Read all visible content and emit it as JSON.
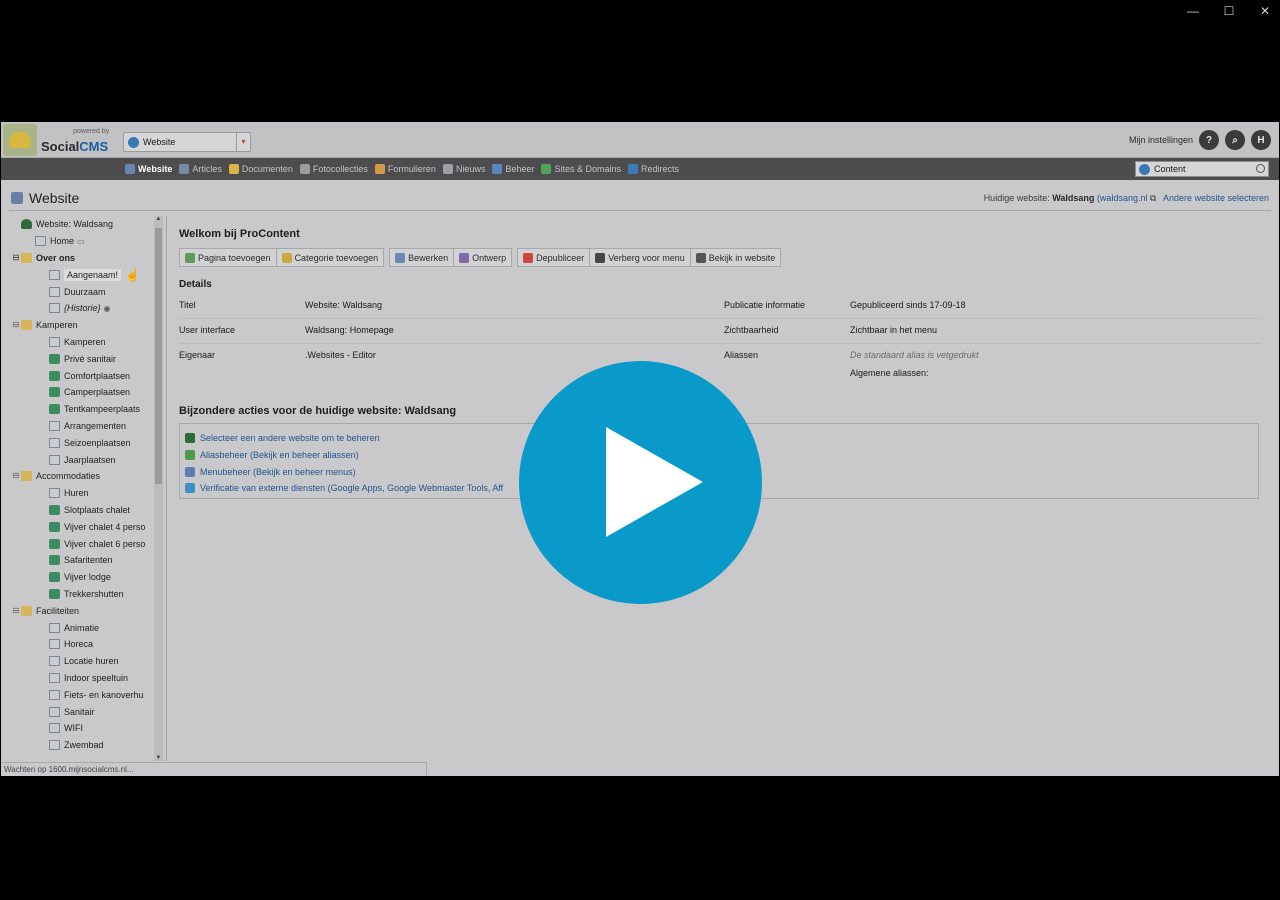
{
  "window": {
    "minimize": "—",
    "maximize": "☐",
    "close": "✕"
  },
  "header": {
    "powered_by": "powered by",
    "brand_social": "Social",
    "brand_cms": "CMS",
    "site_select_value": "Website",
    "settings_label": "Mijn instellingen",
    "help_label": "?",
    "avatar_label": "H"
  },
  "nav": {
    "items": [
      {
        "label": "Website",
        "icon": "website-icon",
        "color": "#6a86b0"
      },
      {
        "label": "Articles",
        "icon": "articles-icon",
        "color": "#7a8aa6"
      },
      {
        "label": "Documenten",
        "icon": "documenten-icon",
        "color": "#d8b545"
      },
      {
        "label": "Fotocollecties",
        "icon": "fotocollecties-icon",
        "color": "#9c9c9c"
      },
      {
        "label": "Formulieren",
        "icon": "formulieren-icon",
        "color": "#d29a48"
      },
      {
        "label": "Nieuws",
        "icon": "nieuws-icon",
        "color": "#9aa0a8"
      },
      {
        "label": "Beheer",
        "icon": "beheer-icon",
        "color": "#5f86b8"
      },
      {
        "label": "Sites & Domains",
        "icon": "sites-domains-icon",
        "color": "#4fa45a"
      },
      {
        "label": "Redirects",
        "icon": "redirects-icon",
        "color": "#3c7bb8"
      }
    ],
    "search_value": "Content"
  },
  "page": {
    "title": "Website",
    "current_label": "Huidige website:",
    "current_name": "Waldsang",
    "current_domain": "(waldsang.nl",
    "other_link": "Andere website selecteren"
  },
  "tree": [
    {
      "label": "Website: Waldsang",
      "icon": "root",
      "indent": 0,
      "toggle": ""
    },
    {
      "label": "Home",
      "icon": "page",
      "indent": 1,
      "toggle": "",
      "suffix": "▭"
    },
    {
      "label": "Over ons",
      "icon": "folder",
      "indent": 0,
      "toggle": "⊟",
      "bold": true
    },
    {
      "label": "Aangenaam!",
      "icon": "page",
      "indent": 2,
      "toggle": "",
      "hl": true
    },
    {
      "label": "Duurzaam",
      "icon": "page",
      "indent": 2,
      "toggle": ""
    },
    {
      "label": "{Historie}",
      "icon": "page",
      "indent": 2,
      "toggle": "",
      "italic": true,
      "suffix": "◉"
    },
    {
      "label": "Kamperen",
      "icon": "folder",
      "indent": 0,
      "toggle": "⊟"
    },
    {
      "label": "Kamperen",
      "icon": "page",
      "indent": 2,
      "toggle": ""
    },
    {
      "label": "Privé sanitair",
      "icon": "leaf",
      "indent": 2,
      "toggle": ""
    },
    {
      "label": "Comfortplaatsen",
      "icon": "leaf",
      "indent": 2,
      "toggle": ""
    },
    {
      "label": "Camperplaatsen",
      "icon": "leaf",
      "indent": 2,
      "toggle": ""
    },
    {
      "label": "Tentkampeerplaats",
      "icon": "leaf",
      "indent": 2,
      "toggle": ""
    },
    {
      "label": "Arrangementen",
      "icon": "page",
      "indent": 2,
      "toggle": ""
    },
    {
      "label": "Seizoenplaatsen",
      "icon": "page",
      "indent": 2,
      "toggle": ""
    },
    {
      "label": "Jaarplaatsen",
      "icon": "page",
      "indent": 2,
      "toggle": ""
    },
    {
      "label": "Accommodaties",
      "icon": "folder",
      "indent": 0,
      "toggle": "⊟"
    },
    {
      "label": "Huren",
      "icon": "page",
      "indent": 2,
      "toggle": ""
    },
    {
      "label": "Slotplaats chalet",
      "icon": "leaf",
      "indent": 2,
      "toggle": ""
    },
    {
      "label": "Vijver chalet 4 perso",
      "icon": "leaf",
      "indent": 2,
      "toggle": ""
    },
    {
      "label": "Vijver chalet 6 perso",
      "icon": "leaf",
      "indent": 2,
      "toggle": ""
    },
    {
      "label": "Safaritenten",
      "icon": "leaf",
      "indent": 2,
      "toggle": ""
    },
    {
      "label": "Vijver lodge",
      "icon": "leaf",
      "indent": 2,
      "toggle": ""
    },
    {
      "label": "Trekkershutten",
      "icon": "leaf",
      "indent": 2,
      "toggle": ""
    },
    {
      "label": "Faciliteiten",
      "icon": "folder",
      "indent": 0,
      "toggle": "⊟"
    },
    {
      "label": "Animatie",
      "icon": "page",
      "indent": 2,
      "toggle": ""
    },
    {
      "label": "Horeca",
      "icon": "page",
      "indent": 2,
      "toggle": ""
    },
    {
      "label": "Locatie huren",
      "icon": "page",
      "indent": 2,
      "toggle": ""
    },
    {
      "label": "Indoor speeltuin",
      "icon": "page",
      "indent": 2,
      "toggle": ""
    },
    {
      "label": "Fiets- en kanoverhu",
      "icon": "page",
      "indent": 2,
      "toggle": ""
    },
    {
      "label": "Sanitair",
      "icon": "page",
      "indent": 2,
      "toggle": ""
    },
    {
      "label": "WIFI",
      "icon": "page",
      "indent": 2,
      "toggle": ""
    },
    {
      "label": "Zwembad",
      "icon": "page",
      "indent": 2,
      "toggle": ""
    }
  ],
  "status_text": "Wachten op 1600.mijnsocialcms.nl...",
  "main": {
    "welcome": "Welkom bij ProContent",
    "toolbar": [
      [
        {
          "label": "Pagina toevoegen",
          "color": "#5f9a5a"
        },
        {
          "label": "Categorie toevoegen",
          "color": "#c9a840"
        }
      ],
      [
        {
          "label": "Bewerken",
          "color": "#6f87b0"
        },
        {
          "label": "Ontwerp",
          "color": "#7a6aa8"
        }
      ],
      [
        {
          "label": "Depubliceer",
          "color": "#c9473b"
        },
        {
          "label": "Verberg voor menu",
          "color": "#444444"
        },
        {
          "label": "Bekijk in website",
          "color": "#555555"
        }
      ]
    ],
    "details_title": "Details",
    "details": [
      {
        "k1": "Titel",
        "v1": "Website: Waldsang",
        "k2": "Publicatie informatie",
        "v2": "Gepubliceerd sinds 17-09-18"
      },
      {
        "k1": "User interface",
        "v1": "Waldsang: Homepage",
        "k2": "Zichtbaarheid",
        "v2": "Zichtbaar in het menu"
      },
      {
        "k1": "Eigenaar",
        "v1": ".Websites - Editor",
        "k2": "Aliassen",
        "v2": "De standaard alias is vetgedrukt",
        "v3": "Algemene aliassen:"
      }
    ],
    "special_title": "Bijzondere acties voor de huidige website: Waldsang",
    "actions": [
      {
        "label": "Selecteer een andere website om te beheren",
        "color": "#2f6a3c"
      },
      {
        "label": "Aliasbeheer (Bekijk en beheer aliassen)",
        "color": "#4f9a4a"
      },
      {
        "label": "Menubeheer (Bekijk en beheer menus)",
        "color": "#5f7fb0"
      },
      {
        "label": "Verificatie van externe diensten (Google Apps, Google Webmaster Tools, Aff",
        "color": "#3e8ec9"
      }
    ]
  }
}
